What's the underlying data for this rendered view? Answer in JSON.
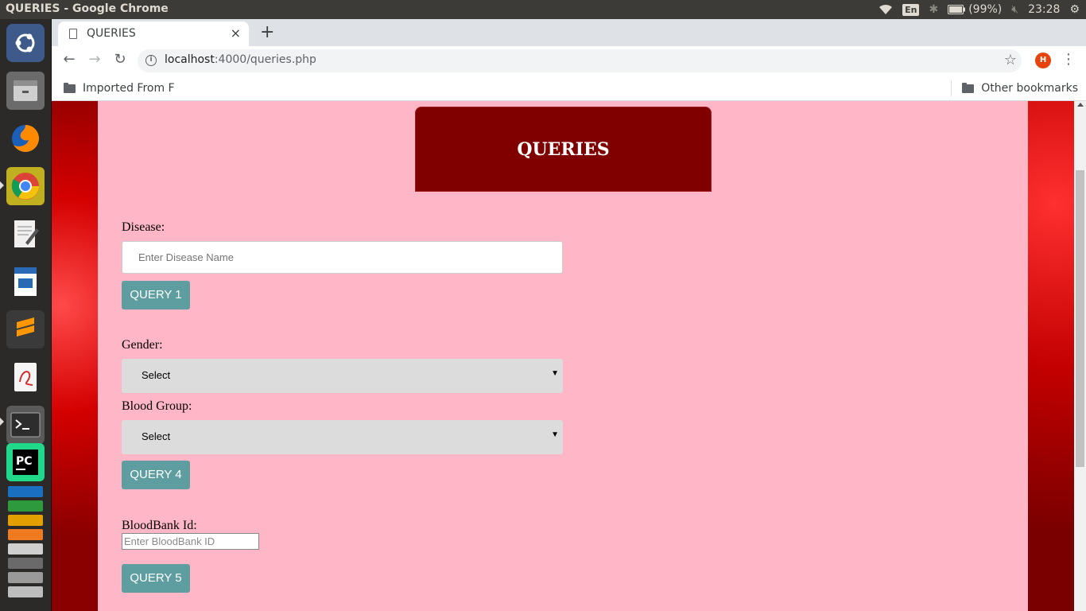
{
  "os": {
    "window_title": "QUERIES - Google Chrome",
    "keyboard_layout": "En",
    "battery": "(99%)",
    "clock": "23:28"
  },
  "launcher": {
    "apps": [
      "ubuntu-dash",
      "files",
      "firefox",
      "chrome",
      "text-editor",
      "libreoffice-writer",
      "sublime-text",
      "document-viewer",
      "terminal",
      "pycharm",
      "stacked-apps"
    ]
  },
  "browser": {
    "tab_title": "QUERIES",
    "tab_close": "×",
    "new_tab": "+",
    "back": "←",
    "forward": "→",
    "reload": "↻",
    "url_host": "localhost",
    "url_path": ":4000/queries.php",
    "star": "☆",
    "profile_initial": "H",
    "menu": "⋮",
    "bookmark_left": "Imported From F",
    "bookmark_right": "Other bookmarks"
  },
  "page": {
    "header_title": "QUERIES",
    "disease_label": "Disease:",
    "disease_placeholder": "Enter Disease Name",
    "query1": "QUERY 1",
    "gender_label": "Gender:",
    "gender_selected": "Select",
    "blood_group_label": "Blood Group:",
    "blood_group_selected": "Select",
    "query4": "QUERY 4",
    "bloodbank_label": "BloodBank Id:",
    "bloodbank_placeholder": "Enter BloodBank ID",
    "query5": "QUERY 5"
  },
  "colors": {
    "page_bg": "#ffb6c6",
    "header_bg": "#800000",
    "button_bg": "#5f9ea0",
    "select_bg": "#dcdcdc"
  }
}
